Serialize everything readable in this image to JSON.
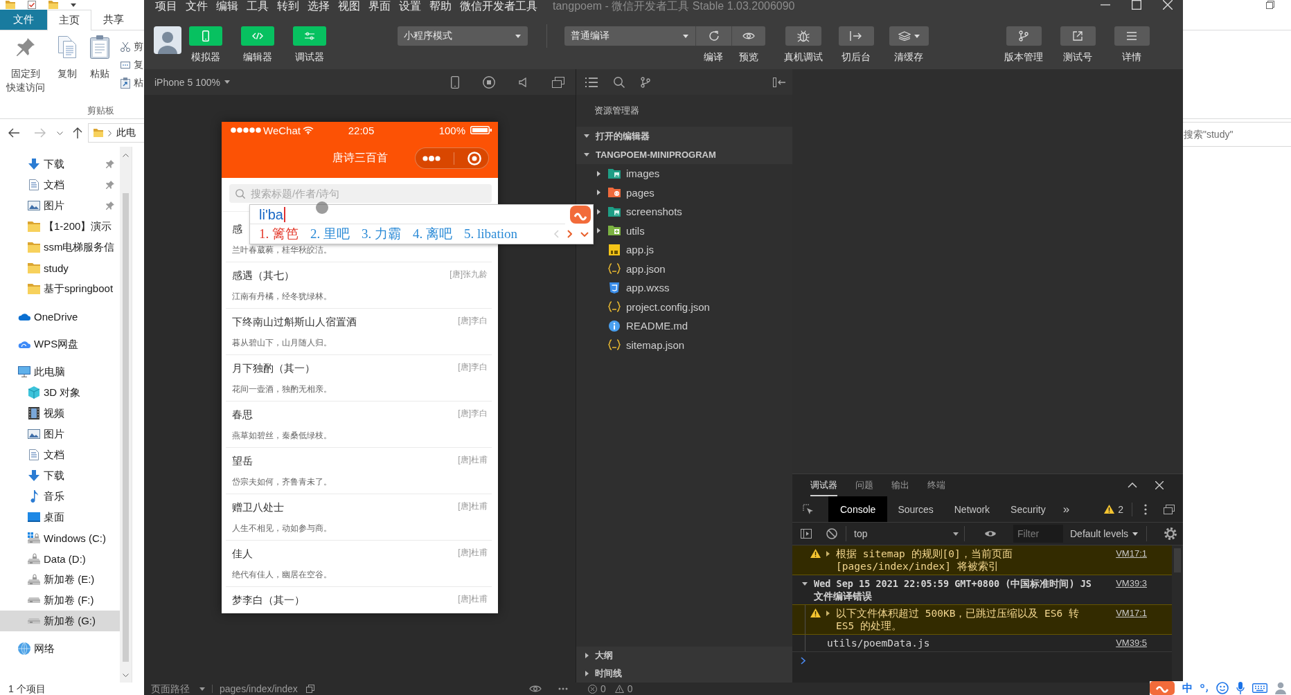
{
  "explorer": {
    "ribbon_tabs": [
      {
        "label": "文件",
        "kind": "file",
        "selected": false
      },
      {
        "label": "主页",
        "kind": "tab",
        "selected": true
      },
      {
        "label": "共享",
        "kind": "tab",
        "selected": false
      }
    ],
    "ribbon_buttons": [
      {
        "lines": [
          "固定到",
          "快速访问"
        ],
        "kind": "pin"
      },
      {
        "lines": [
          "复制"
        ],
        "kind": "copy"
      },
      {
        "lines": [
          "粘贴"
        ],
        "kind": "paste"
      }
    ],
    "ribbon_small_buttons": [
      {
        "label": "剪",
        "kind": "cut"
      },
      {
        "label": "复",
        "kind": "copypath"
      },
      {
        "label": "粘",
        "kind": "shortcut"
      }
    ],
    "ribbon_group": "剪贴板",
    "address": "此电",
    "quick_access": [
      {
        "label": "下载",
        "kind": "download",
        "pinned": true,
        "selected": false
      },
      {
        "label": "文档",
        "kind": "document",
        "pinned": true,
        "selected": false
      },
      {
        "label": "图片",
        "kind": "picture",
        "pinned": true,
        "selected": false
      },
      {
        "label": "【1-200】演示",
        "kind": "folder",
        "pinned": false,
        "selected": false
      },
      {
        "label": "ssm电梯服务信",
        "kind": "folder",
        "pinned": false,
        "selected": false
      },
      {
        "label": "study",
        "kind": "folder",
        "pinned": false,
        "selected": false
      },
      {
        "label": "基于springboot",
        "kind": "folder",
        "pinned": false,
        "selected": false
      }
    ],
    "nav_tree": [
      {
        "label": "OneDrive",
        "kind": "onedrive",
        "selected": false
      },
      {
        "label": "WPS网盘",
        "kind": "wps",
        "selected": false
      },
      {
        "label": "此电脑",
        "kind": "computer",
        "selected": false,
        "children": [
          {
            "label": "3D 对象",
            "kind": "cube",
            "selected": false
          },
          {
            "label": "视频",
            "kind": "video",
            "selected": false
          },
          {
            "label": "图片",
            "kind": "picture",
            "selected": false
          },
          {
            "label": "文档",
            "kind": "document",
            "selected": false
          },
          {
            "label": "下载",
            "kind": "download",
            "selected": false
          },
          {
            "label": "音乐",
            "kind": "music",
            "selected": false
          },
          {
            "label": "桌面",
            "kind": "desktop",
            "selected": false
          },
          {
            "label": "Windows (C:)",
            "kind": "windrive",
            "selected": false
          },
          {
            "label": "Data (D:)",
            "kind": "lockeddrive",
            "selected": false
          },
          {
            "label": "新加卷 (E:)",
            "kind": "lockeddrive",
            "selected": false
          },
          {
            "label": "新加卷 (F:)",
            "kind": "drive",
            "selected": false
          },
          {
            "label": "新加卷 (G:)",
            "kind": "drive",
            "selected": true
          }
        ]
      },
      {
        "label": "网络",
        "kind": "network",
        "selected": false
      }
    ],
    "status": "1 个项目",
    "search_placeholder": "搜索\"study\""
  },
  "devtools": {
    "menu": [
      "项目",
      "文件",
      "编辑",
      "工具",
      "转到",
      "选择",
      "视图",
      "界面",
      "设置",
      "帮助",
      "微信开发者工具"
    ],
    "title": "tangpoem - 微信开发者工具 Stable 1.03.2006090",
    "view_toggles": [
      {
        "label": "模拟器",
        "kind": "simulator",
        "on": true
      },
      {
        "label": "编辑器",
        "kind": "editor",
        "on": true
      },
      {
        "label": "调试器",
        "kind": "debugger",
        "on": true
      }
    ],
    "mode_select": "小程序模式",
    "compile_select": "普通编译",
    "compile_actions": [
      {
        "label": "编译",
        "kind": "compile"
      },
      {
        "label": "预览",
        "kind": "preview"
      }
    ],
    "actions": [
      {
        "label": "真机调试",
        "kind": "remote"
      },
      {
        "label": "切后台",
        "kind": "background"
      },
      {
        "label": "清缓存",
        "kind": "cache"
      }
    ],
    "right_actions": [
      {
        "label": "版本管理",
        "kind": "version"
      },
      {
        "label": "测试号",
        "kind": "testid"
      },
      {
        "label": "详情",
        "kind": "details"
      }
    ],
    "device": "iPhone 5 100%",
    "simulator": {
      "carrier": "WeChat",
      "time": "22:05",
      "battery": "100%",
      "title": "唐诗三百首",
      "search_placeholder": "搜索标题/作者/诗句",
      "poems": [
        {
          "title": "感",
          "line": "兰叶春葳蕤，桂华秋皎洁。"
        },
        {
          "title": "感遇（其七）",
          "author": "[唐]张九龄",
          "line": "江南有丹橘，经冬犹绿林。"
        },
        {
          "title": "下终南山过斛斯山人宿置酒",
          "author": "[唐]李白",
          "line": "暮从碧山下，山月随人归。"
        },
        {
          "title": "月下独酌（其一）",
          "author": "[唐]李白",
          "line": "花间一壶酒，独酌无相亲。"
        },
        {
          "title": "春思",
          "author": "[唐]李白",
          "line": "燕草如碧丝，秦桑低绿枝。"
        },
        {
          "title": "望岳",
          "author": "[唐]杜甫",
          "line": "岱宗夫如何，齐鲁青未了。"
        },
        {
          "title": "赠卫八处士",
          "author": "[唐]杜甫",
          "line": "人生不相见，动如参与商。"
        },
        {
          "title": "佳人",
          "author": "[唐]杜甫",
          "line": "绝代有佳人，幽居在空谷。"
        },
        {
          "title": "梦李白（其一）",
          "author": "[唐]杜甫"
        }
      ]
    },
    "file_explorer": {
      "title": "资源管理器",
      "sections": [
        {
          "label": "打开的编辑器",
          "expanded": true
        },
        {
          "label": "TANGPOEM-MINIPROGRAM",
          "expanded": true,
          "folders": [
            {
              "name": "images",
              "kind": "imagefolder",
              "expanded": false
            },
            {
              "name": "pages",
              "kind": "pagefolder",
              "expanded": false
            },
            {
              "name": "screenshots",
              "kind": "imagefolder",
              "expanded": false
            },
            {
              "name": "utils",
              "kind": "utilfolder",
              "expanded": false
            }
          ],
          "files": [
            {
              "name": "app.js",
              "kind": "script"
            },
            {
              "name": "app.json",
              "kind": "json"
            },
            {
              "name": "app.wxss",
              "kind": "stylesheet"
            },
            {
              "name": "project.config.json",
              "kind": "json"
            },
            {
              "name": "README.md",
              "kind": "info"
            },
            {
              "name": "sitemap.json",
              "kind": "json"
            }
          ]
        }
      ],
      "panels": [
        {
          "label": "大纲",
          "expanded": false
        },
        {
          "label": "时间线",
          "expanded": false
        }
      ]
    },
    "path_bar": {
      "label": "页面路径",
      "path": "pages/index/index"
    },
    "problems": {
      "errors": "0",
      "warnings": "0"
    },
    "console": {
      "panel_tabs": [
        {
          "label": "调试器",
          "selected": true
        },
        {
          "label": "问题",
          "selected": false
        },
        {
          "label": "输出",
          "selected": false
        },
        {
          "label": "终端",
          "selected": false
        }
      ],
      "tabs": [
        {
          "label": "Console",
          "selected": true
        },
        {
          "label": "Sources",
          "selected": false
        },
        {
          "label": "Network",
          "selected": false
        },
        {
          "label": "Security",
          "selected": false
        }
      ],
      "more": "»",
      "warning_count": "2",
      "context": "top",
      "filter_placeholder": "Filter",
      "levels": "Default levels",
      "messages": [
        {
          "kind": "warning",
          "expanded": false,
          "text": "根据 sitemap 的规则[0]，当前页面 [pages/index/index] 将被索引",
          "source": "VM17:1"
        },
        {
          "kind": "group",
          "expanded": true,
          "text": "Wed Sep 15 2021 22:05:59 GMT+0800 (中国标准时间) JS 文件编译错误",
          "source": "VM39:3",
          "children": [
            {
              "kind": "warning",
              "expanded": false,
              "text": "以下文件体积超过 500KB，已跳过压缩以及 ES6 转 ES5 的处理。",
              "source": "VM17:1"
            },
            {
              "kind": "log",
              "text": "utils/poemData.js",
              "source": "VM39:5"
            }
          ]
        }
      ]
    }
  },
  "ime": {
    "input": "li'ba",
    "candidates": [
      {
        "label": "1. 篱笆",
        "selected": true
      },
      {
        "label": "2. 里吧",
        "selected": false
      },
      {
        "label": "3. 力霸",
        "selected": false
      },
      {
        "label": "4. 离吧",
        "selected": false
      },
      {
        "label": "5. libation",
        "selected": false
      }
    ]
  },
  "ime_toolbar": {
    "mode": "中"
  }
}
